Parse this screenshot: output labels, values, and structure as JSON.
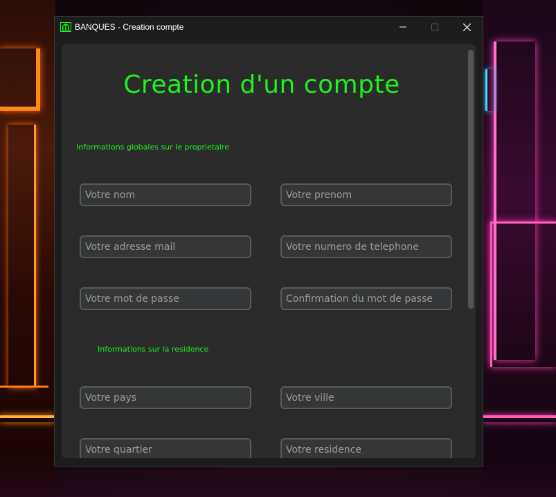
{
  "window": {
    "title": "BANQUES - Creation compte",
    "icon": "bank-icon",
    "controls": {
      "minimize": "minimize-icon",
      "maximize": "maximize-icon",
      "close": "close-icon"
    }
  },
  "form": {
    "heading": "Creation d'un compte",
    "owner_section": "Informations globales sur le proprietaire",
    "residence_section": "Informations sur la residence",
    "fields": {
      "nom": {
        "placeholder": "Votre nom",
        "value": ""
      },
      "prenom": {
        "placeholder": "Votre prenom",
        "value": ""
      },
      "mail": {
        "placeholder": "Votre adresse mail",
        "value": ""
      },
      "telephone": {
        "placeholder": "Votre numero de telephone",
        "value": ""
      },
      "password": {
        "placeholder": "Votre mot de passe",
        "value": ""
      },
      "password_confirm": {
        "placeholder": "Confirmation du mot de passe",
        "value": ""
      },
      "pays": {
        "placeholder": "Votre pays",
        "value": ""
      },
      "ville": {
        "placeholder": "Votre ville",
        "value": ""
      },
      "quartier": {
        "placeholder": "Votre quartier",
        "value": ""
      },
      "residence": {
        "placeholder": "Votre residence",
        "value": ""
      }
    }
  },
  "colors": {
    "accent": "#1cf21c",
    "window_bg": "#1c1c1c",
    "panel_bg": "#2b2b2b",
    "field_bg": "#343638",
    "field_border": "#565b5e"
  }
}
